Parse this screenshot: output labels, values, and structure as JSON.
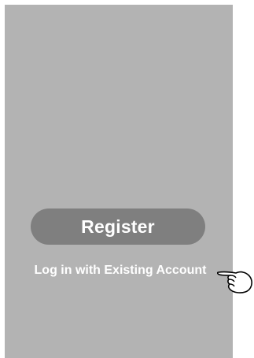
{
  "screen": {
    "background_color": "#b3b3b3"
  },
  "actions": {
    "register_label": "Register",
    "login_label": "Log in with Existing Account"
  },
  "pointer": {
    "icon": "pointing-hand-icon"
  },
  "colors": {
    "button": "#7f7f7f",
    "text": "#ffffff"
  }
}
